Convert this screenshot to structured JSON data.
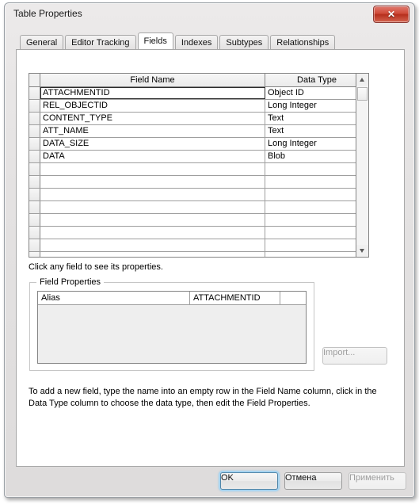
{
  "window": {
    "title": "Table Properties",
    "close_label": "✕"
  },
  "tabs": [
    {
      "label": "General",
      "active": false
    },
    {
      "label": "Editor Tracking",
      "active": false
    },
    {
      "label": "Fields",
      "active": true
    },
    {
      "label": "Indexes",
      "active": false
    },
    {
      "label": "Subtypes",
      "active": false
    },
    {
      "label": "Relationships",
      "active": false
    }
  ],
  "fields_grid": {
    "columns": [
      "Field Name",
      "Data Type"
    ],
    "rows": [
      {
        "name": "ATTACHMENTID",
        "type": "Object ID"
      },
      {
        "name": "REL_OBJECTID",
        "type": "Long Integer"
      },
      {
        "name": "CONTENT_TYPE",
        "type": "Text"
      },
      {
        "name": "ATT_NAME",
        "type": "Text"
      },
      {
        "name": "DATA_SIZE",
        "type": "Long Integer"
      },
      {
        "name": "DATA",
        "type": "Blob"
      },
      {
        "name": "",
        "type": ""
      },
      {
        "name": "",
        "type": ""
      },
      {
        "name": "",
        "type": ""
      },
      {
        "name": "",
        "type": ""
      },
      {
        "name": "",
        "type": ""
      },
      {
        "name": "",
        "type": ""
      },
      {
        "name": "",
        "type": ""
      },
      {
        "name": "",
        "type": ""
      }
    ],
    "selected_row_index": 0
  },
  "hint": "Click any field to see its properties.",
  "field_properties": {
    "group_title": "Field Properties",
    "rows": [
      {
        "label": "Alias",
        "value": "ATTACHMENTID"
      }
    ]
  },
  "import_button": {
    "label": "Import...",
    "enabled": false
  },
  "instruction": "To add a new field, type the name into an empty row in the Field Name column, click in the Data Type column to choose the data type, then edit the Field Properties.",
  "footer": {
    "ok": {
      "label": "OK",
      "enabled": true,
      "default": true
    },
    "cancel": {
      "label": "Отмена",
      "enabled": true
    },
    "apply": {
      "label": "Применить",
      "enabled": false
    }
  },
  "colors": {
    "close_button": "#c6452f",
    "focus_ring": "#a8d4f0",
    "grid_line": "#9f9f9f"
  }
}
